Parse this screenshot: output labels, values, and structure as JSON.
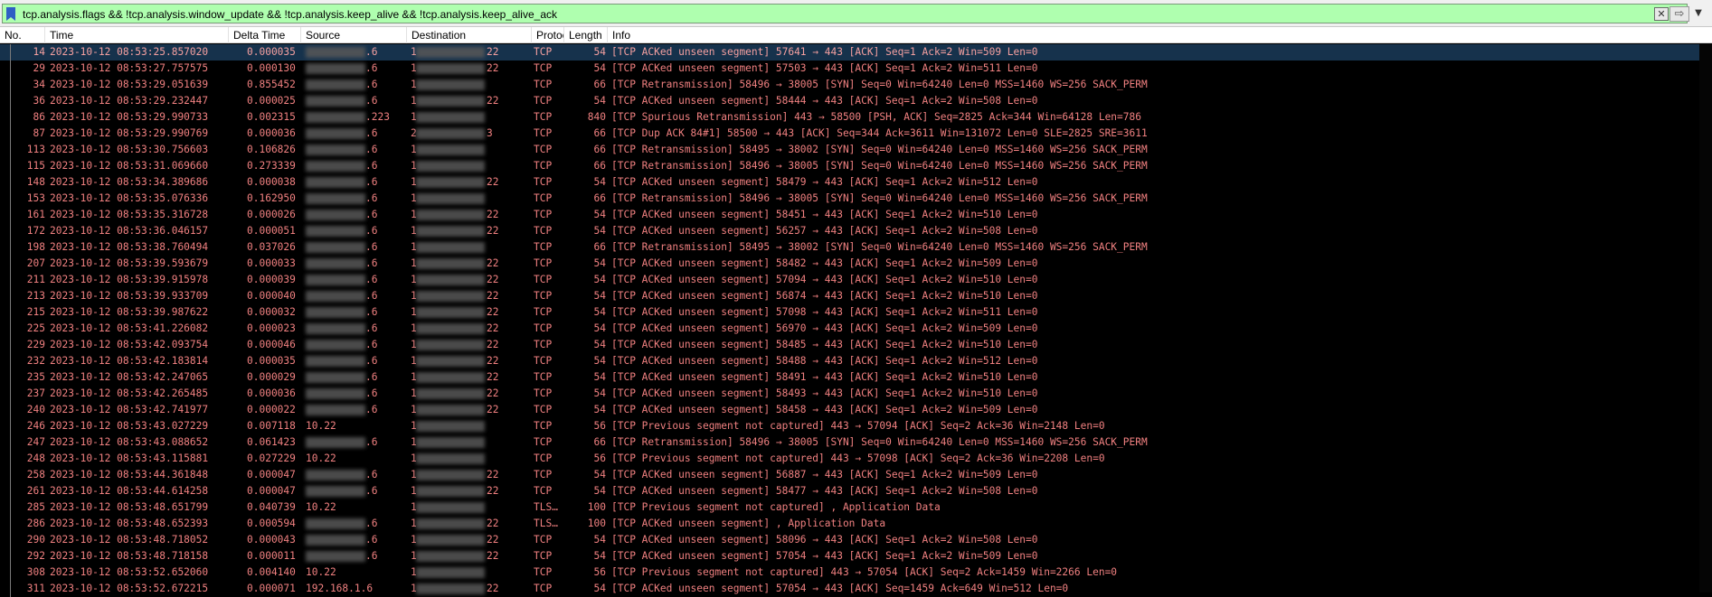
{
  "filter": {
    "expression": "tcp.analysis.flags && !tcp.analysis.window_update && !tcp.analysis.keep_alive && !tcp.analysis.keep_alive_ack",
    "clear_glyph": "✕",
    "apply_glyph": "⇨",
    "dropdown_glyph": "▼",
    "bg_color": "#afffaf"
  },
  "columns": [
    {
      "key": "no",
      "label": "No."
    },
    {
      "key": "time",
      "label": "Time"
    },
    {
      "key": "delta",
      "label": "Delta Time"
    },
    {
      "key": "src",
      "label": "Source"
    },
    {
      "key": "dst",
      "label": "Destination"
    },
    {
      "key": "proto",
      "label": "Protocol"
    },
    {
      "key": "len",
      "label": "Length"
    },
    {
      "key": "info",
      "label": "Info"
    }
  ],
  "colors": {
    "row_text": "#f08080",
    "selected_bg": "#16324c",
    "list_bg": "#000000"
  },
  "packets": [
    {
      "no": "14",
      "time": "2023-10-12 08:53:25.857020",
      "delta": "0.000035",
      "src": ".6",
      "dst_pre": "1",
      "dst": "22",
      "proto": "TCP",
      "len": "54",
      "info": "[TCP ACKed unseen segment] 57641 → 443 [ACK] Seq=1 Ack=2 Win=509 Len=0",
      "selected": true
    },
    {
      "no": "29",
      "time": "2023-10-12 08:53:27.757575",
      "delta": "0.000130",
      "src": ".6",
      "dst_pre": "1",
      "dst": "22",
      "proto": "TCP",
      "len": "54",
      "info": "[TCP ACKed unseen segment] 57503 → 443 [ACK] Seq=1 Ack=2 Win=511 Len=0"
    },
    {
      "no": "34",
      "time": "2023-10-12 08:53:29.051639",
      "delta": "0.855452",
      "src": ".6",
      "dst_pre": "1",
      "dst": "",
      "proto": "TCP",
      "len": "66",
      "info": "[TCP Retransmission] 58496 → 38005 [SYN] Seq=0 Win=64240 Len=0 MSS=1460 WS=256 SACK_PERM"
    },
    {
      "no": "36",
      "time": "2023-10-12 08:53:29.232447",
      "delta": "0.000025",
      "src": ".6",
      "dst_pre": "1",
      "dst": "22",
      "proto": "TCP",
      "len": "54",
      "info": "[TCP ACKed unseen segment] 58444 → 443 [ACK] Seq=1 Ack=2 Win=508 Len=0"
    },
    {
      "no": "86",
      "time": "2023-10-12 08:53:29.990733",
      "delta": "0.002315",
      "src": ".223",
      "dst_pre": "1",
      "dst": "",
      "proto": "TCP",
      "len": "840",
      "info": "[TCP Spurious Retransmission] 443 → 58500 [PSH, ACK] Seq=2825 Ack=344 Win=64128 Len=786"
    },
    {
      "no": "87",
      "time": "2023-10-12 08:53:29.990769",
      "delta": "0.000036",
      "src": ".6",
      "dst_pre": "2",
      "dst": "3",
      "proto": "TCP",
      "len": "66",
      "info": "[TCP Dup ACK 84#1] 58500 → 443 [ACK] Seq=344 Ack=3611 Win=131072 Len=0 SLE=2825 SRE=3611"
    },
    {
      "no": "113",
      "time": "2023-10-12 08:53:30.756603",
      "delta": "0.106826",
      "src": ".6",
      "dst_pre": "1",
      "dst": "",
      "proto": "TCP",
      "len": "66",
      "info": "[TCP Retransmission] 58495 → 38002 [SYN] Seq=0 Win=64240 Len=0 MSS=1460 WS=256 SACK_PERM"
    },
    {
      "no": "115",
      "time": "2023-10-12 08:53:31.069660",
      "delta": "0.273339",
      "src": ".6",
      "dst_pre": "1",
      "dst": "",
      "proto": "TCP",
      "len": "66",
      "info": "[TCP Retransmission] 58496 → 38005 [SYN] Seq=0 Win=64240 Len=0 MSS=1460 WS=256 SACK_PERM"
    },
    {
      "no": "148",
      "time": "2023-10-12 08:53:34.389686",
      "delta": "0.000038",
      "src": ".6",
      "dst_pre": "1",
      "dst": "22",
      "proto": "TCP",
      "len": "54",
      "info": "[TCP ACKed unseen segment] 58479 → 443 [ACK] Seq=1 Ack=2 Win=512 Len=0"
    },
    {
      "no": "153",
      "time": "2023-10-12 08:53:35.076336",
      "delta": "0.162950",
      "src": ".6",
      "dst_pre": "1",
      "dst": "",
      "proto": "TCP",
      "len": "66",
      "info": "[TCP Retransmission] 58496 → 38005 [SYN] Seq=0 Win=64240 Len=0 MSS=1460 WS=256 SACK_PERM"
    },
    {
      "no": "161",
      "time": "2023-10-12 08:53:35.316728",
      "delta": "0.000026",
      "src": ".6",
      "dst_pre": "1",
      "dst": "22",
      "proto": "TCP",
      "len": "54",
      "info": "[TCP ACKed unseen segment] 58451 → 443 [ACK] Seq=1 Ack=2 Win=510 Len=0"
    },
    {
      "no": "172",
      "time": "2023-10-12 08:53:36.046157",
      "delta": "0.000051",
      "src": ".6",
      "dst_pre": "1",
      "dst": "22",
      "proto": "TCP",
      "len": "54",
      "info": "[TCP ACKed unseen segment] 56257 → 443 [ACK] Seq=1 Ack=2 Win=508 Len=0"
    },
    {
      "no": "198",
      "time": "2023-10-12 08:53:38.760494",
      "delta": "0.037026",
      "src": ".6",
      "dst_pre": "1",
      "dst": "",
      "proto": "TCP",
      "len": "66",
      "info": "[TCP Retransmission] 58495 → 38002 [SYN] Seq=0 Win=64240 Len=0 MSS=1460 WS=256 SACK_PERM"
    },
    {
      "no": "207",
      "time": "2023-10-12 08:53:39.593679",
      "delta": "0.000033",
      "src": ".6",
      "dst_pre": "1",
      "dst": "22",
      "proto": "TCP",
      "len": "54",
      "info": "[TCP ACKed unseen segment] 58482 → 443 [ACK] Seq=1 Ack=2 Win=509 Len=0"
    },
    {
      "no": "211",
      "time": "2023-10-12 08:53:39.915978",
      "delta": "0.000039",
      "src": ".6",
      "dst_pre": "1",
      "dst": "22",
      "proto": "TCP",
      "len": "54",
      "info": "[TCP ACKed unseen segment] 57094 → 443 [ACK] Seq=1 Ack=2 Win=510 Len=0"
    },
    {
      "no": "213",
      "time": "2023-10-12 08:53:39.933709",
      "delta": "0.000040",
      "src": ".6",
      "dst_pre": "1",
      "dst": "22",
      "proto": "TCP",
      "len": "54",
      "info": "[TCP ACKed unseen segment] 56874 → 443 [ACK] Seq=1 Ack=2 Win=510 Len=0"
    },
    {
      "no": "215",
      "time": "2023-10-12 08:53:39.987622",
      "delta": "0.000032",
      "src": ".6",
      "dst_pre": "1",
      "dst": "22",
      "proto": "TCP",
      "len": "54",
      "info": "[TCP ACKed unseen segment] 57098 → 443 [ACK] Seq=1 Ack=2 Win=511 Len=0"
    },
    {
      "no": "225",
      "time": "2023-10-12 08:53:41.226082",
      "delta": "0.000023",
      "src": ".6",
      "dst_pre": "1",
      "dst": "22",
      "proto": "TCP",
      "len": "54",
      "info": "[TCP ACKed unseen segment] 56970 → 443 [ACK] Seq=1 Ack=2 Win=509 Len=0"
    },
    {
      "no": "229",
      "time": "2023-10-12 08:53:42.093754",
      "delta": "0.000046",
      "src": ".6",
      "dst_pre": "1",
      "dst": "22",
      "proto": "TCP",
      "len": "54",
      "info": "[TCP ACKed unseen segment] 58485 → 443 [ACK] Seq=1 Ack=2 Win=510 Len=0"
    },
    {
      "no": "232",
      "time": "2023-10-12 08:53:42.183814",
      "delta": "0.000035",
      "src": ".6",
      "dst_pre": "1",
      "dst": "22",
      "proto": "TCP",
      "len": "54",
      "info": "[TCP ACKed unseen segment] 58488 → 443 [ACK] Seq=1 Ack=2 Win=512 Len=0"
    },
    {
      "no": "235",
      "time": "2023-10-12 08:53:42.247065",
      "delta": "0.000029",
      "src": ".6",
      "dst_pre": "1",
      "dst": "22",
      "proto": "TCP",
      "len": "54",
      "info": "[TCP ACKed unseen segment] 58491 → 443 [ACK] Seq=1 Ack=2 Win=510 Len=0"
    },
    {
      "no": "237",
      "time": "2023-10-12 08:53:42.265485",
      "delta": "0.000036",
      "src": ".6",
      "dst_pre": "1",
      "dst": "22",
      "proto": "TCP",
      "len": "54",
      "info": "[TCP ACKed unseen segment] 58493 → 443 [ACK] Seq=1 Ack=2 Win=510 Len=0"
    },
    {
      "no": "240",
      "time": "2023-10-12 08:53:42.741977",
      "delta": "0.000022",
      "src": ".6",
      "dst_pre": "1",
      "dst": "22",
      "proto": "TCP",
      "len": "54",
      "info": "[TCP ACKed unseen segment] 58458 → 443 [ACK] Seq=1 Ack=2 Win=509 Len=0"
    },
    {
      "no": "246",
      "time": "2023-10-12 08:53:43.027229",
      "delta": "0.007118",
      "src": "10.22",
      "dst_pre": "1",
      "dst": "",
      "proto": "TCP",
      "len": "56",
      "info": "[TCP Previous segment not captured] 443 → 57094 [ACK] Seq=2 Ack=36 Win=2148 Len=0",
      "src_wide": true
    },
    {
      "no": "247",
      "time": "2023-10-12 08:53:43.088652",
      "delta": "0.061423",
      "src": ".6",
      "dst_pre": "1",
      "dst": "",
      "proto": "TCP",
      "len": "66",
      "info": "[TCP Retransmission] 58496 → 38005 [SYN] Seq=0 Win=64240 Len=0 MSS=1460 WS=256 SACK_PERM"
    },
    {
      "no": "248",
      "time": "2023-10-12 08:53:43.115881",
      "delta": "0.027229",
      "src": "10.22",
      "dst_pre": "1",
      "dst": "",
      "proto": "TCP",
      "len": "56",
      "info": "[TCP Previous segment not captured] 443 → 57098 [ACK] Seq=2 Ack=36 Win=2208 Len=0",
      "src_wide": true
    },
    {
      "no": "258",
      "time": "2023-10-12 08:53:44.361848",
      "delta": "0.000047",
      "src": ".6",
      "dst_pre": "1",
      "dst": "22",
      "proto": "TCP",
      "len": "54",
      "info": "[TCP ACKed unseen segment] 56887 → 443 [ACK] Seq=1 Ack=2 Win=509 Len=0"
    },
    {
      "no": "261",
      "time": "2023-10-12 08:53:44.614258",
      "delta": "0.000047",
      "src": ".6",
      "dst_pre": "1",
      "dst": "22",
      "proto": "TCP",
      "len": "54",
      "info": "[TCP ACKed unseen segment] 58477 → 443 [ACK] Seq=1 Ack=2 Win=508 Len=0"
    },
    {
      "no": "285",
      "time": "2023-10-12 08:53:48.651799",
      "delta": "0.040739",
      "src": "10.22",
      "dst_pre": "1",
      "dst": "",
      "proto": "TLS…",
      "len": "100",
      "info": "[TCP Previous segment not captured] , Application Data",
      "src_wide": true
    },
    {
      "no": "286",
      "time": "2023-10-12 08:53:48.652393",
      "delta": "0.000594",
      "src": ".6",
      "dst_pre": "1",
      "dst": "22",
      "proto": "TLS…",
      "len": "100",
      "info": "[TCP ACKed unseen segment] , Application Data"
    },
    {
      "no": "290",
      "time": "2023-10-12 08:53:48.718052",
      "delta": "0.000043",
      "src": ".6",
      "dst_pre": "1",
      "dst": "22",
      "proto": "TCP",
      "len": "54",
      "info": "[TCP ACKed unseen segment] 58096 → 443 [ACK] Seq=1 Ack=2 Win=508 Len=0"
    },
    {
      "no": "292",
      "time": "2023-10-12 08:53:48.718158",
      "delta": "0.000011",
      "src": ".6",
      "dst_pre": "1",
      "dst": "22",
      "proto": "TCP",
      "len": "54",
      "info": "[TCP ACKed unseen segment] 57054 → 443 [ACK] Seq=1 Ack=2 Win=509 Len=0"
    },
    {
      "no": "308",
      "time": "2023-10-12 08:53:52.652060",
      "delta": "0.004140",
      "src": "10.22",
      "dst_pre": "1",
      "dst": "",
      "proto": "TCP",
      "len": "56",
      "info": "[TCP Previous segment not captured] 443 → 57054 [ACK] Seq=2 Ack=1459 Win=2266 Len=0",
      "src_wide": true
    },
    {
      "no": "311",
      "time": "2023-10-12 08:53:52.672215",
      "delta": "0.000071",
      "src": "192.168.1.6",
      "dst_pre": "1",
      "dst": "22",
      "proto": "TCP",
      "len": "54",
      "info": "[TCP ACKed unseen segment] 57054 → 443 [ACK] Seq=1459 Ack=649 Win=512 Len=0"
    }
  ]
}
